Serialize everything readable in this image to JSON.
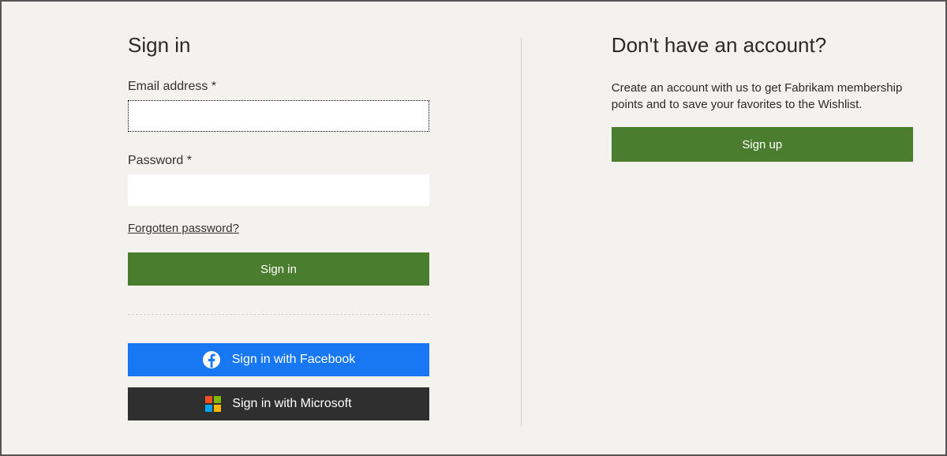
{
  "signin": {
    "heading": "Sign in",
    "email_label": "Email address *",
    "email_value": "",
    "password_label": "Password *",
    "password_value": "",
    "forgot_link": "Forgotten password?",
    "signin_button": "Sign in",
    "facebook_button": "Sign in with Facebook",
    "microsoft_button": "Sign in with Microsoft"
  },
  "signup": {
    "heading": "Don't have an account?",
    "description": "Create an account with us to get Fabrikam membership points and to save your favorites to the Wishlist.",
    "button": "Sign up"
  },
  "colors": {
    "primary": "#4b7d2f",
    "facebook": "#1877f2",
    "microsoft": "#2f2f2f",
    "background": "#f4f2ee"
  }
}
